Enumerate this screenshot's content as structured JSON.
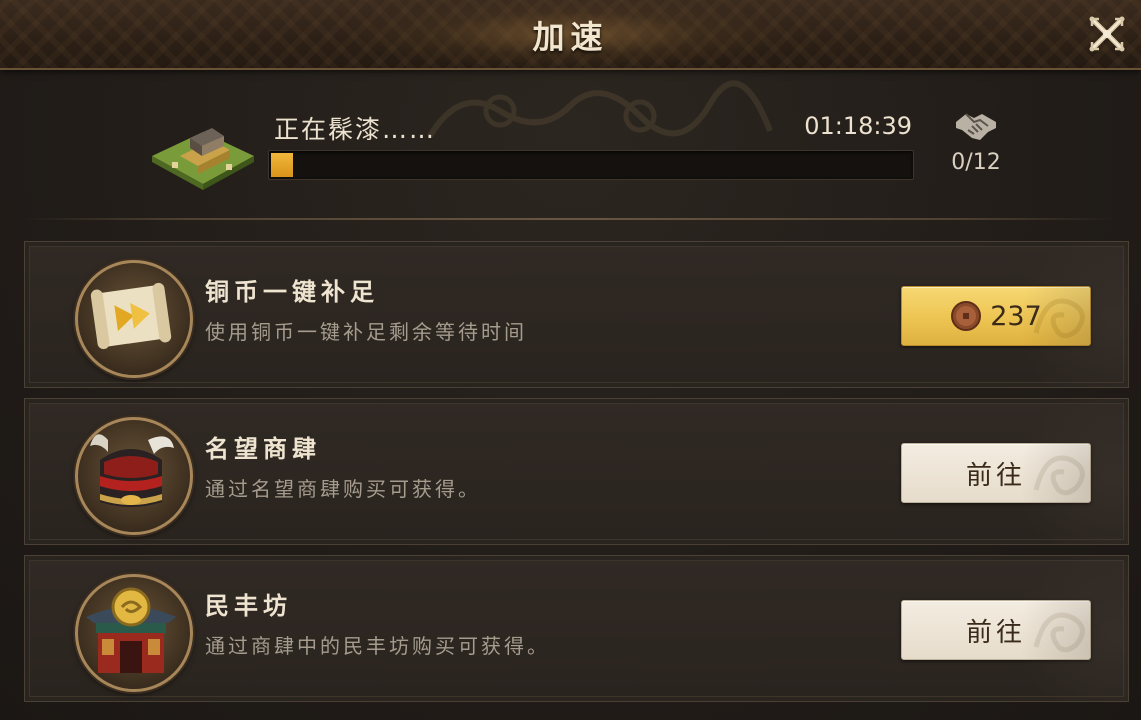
{
  "window": {
    "title": "加速"
  },
  "icons": {
    "close": "close-x-icon",
    "help": "handshake-icon",
    "building": "building-tile-icon",
    "coin": "copper-coin-icon"
  },
  "progress": {
    "status": "正在髹漆……",
    "timer": "01:18:39",
    "fraction": 0.035,
    "help_count": "0/12"
  },
  "options": [
    {
      "icon": "scroll-arrow-icon",
      "title": "铜币一键补足",
      "description": "使用铜币一键补足剩余等待时间",
      "button_type": "price",
      "price": "237"
    },
    {
      "icon": "helmet-icon",
      "title": "名望商肆",
      "description": "通过名望商肆购买可获得。",
      "button_type": "go",
      "button_label": "前往"
    },
    {
      "icon": "shop-building-icon",
      "title": "民丰坊",
      "description": "通过商肆中的民丰坊购买可获得。",
      "button_type": "go",
      "button_label": "前往"
    }
  ],
  "colors": {
    "gold_button": "#edc452",
    "light_button": "#e6dccb",
    "progress_fill": "#e4a52a",
    "panel_bg": "#221d19"
  }
}
